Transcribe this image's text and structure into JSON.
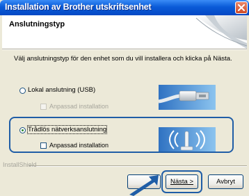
{
  "window": {
    "title": "Installation av Brother utskriftsenhet"
  },
  "header": {
    "title": "Anslutningstyp"
  },
  "instruction": "Välj anslutningstyp för den enhet som du vill installera och klicka på Nästa.",
  "options": [
    {
      "label": "Lokal anslutning (USB)",
      "selected": false,
      "sub_checkbox": {
        "label": "Anpassad installation",
        "checked": false,
        "disabled": true
      },
      "image": "usb-cable-image"
    },
    {
      "label": "Trådlös nätverksanslutning",
      "selected": true,
      "sub_checkbox": {
        "label": "Anpassad installation",
        "checked": false,
        "disabled": false
      },
      "image": "wireless-antenna-image"
    }
  ],
  "footer": {
    "brand": "InstallShield"
  },
  "buttons": {
    "back": "",
    "next": "Nästa >",
    "cancel": "Avbryt"
  },
  "colors": {
    "titlebar": "#0a5bd8",
    "highlight": "#1f5da6",
    "dialog_bg": "#ece9d8"
  }
}
